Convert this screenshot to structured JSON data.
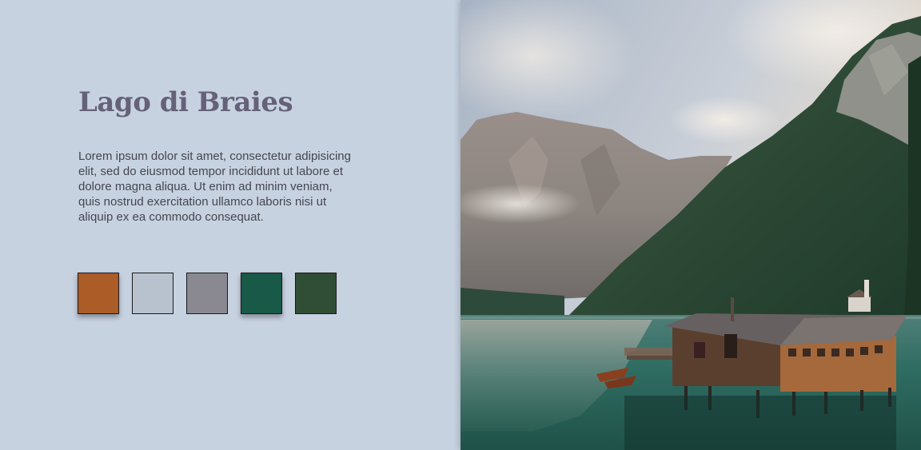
{
  "title": "Lago di Braies",
  "description": "Lorem ipsum dolor sit amet, consectetur adipisicing elit, sed do eiusmod tempor incididunt ut labore et dolore magna aliqua. Ut enim ad minim veniam, quis nostrud exercitation ullamco laboris nisi ut aliquip ex ea commodo consequat.",
  "palette": [
    {
      "name": "burnt-orange",
      "color": "#ab5c27"
    },
    {
      "name": "pale-blue-gray",
      "color": "#b8c2ce"
    },
    {
      "name": "gray",
      "color": "#8a8890"
    },
    {
      "name": "teal-green",
      "color": "#185947"
    },
    {
      "name": "forest-green",
      "color": "#304e35"
    }
  ],
  "image": {
    "subject": "Lake with mountains and wooden boathouse"
  }
}
